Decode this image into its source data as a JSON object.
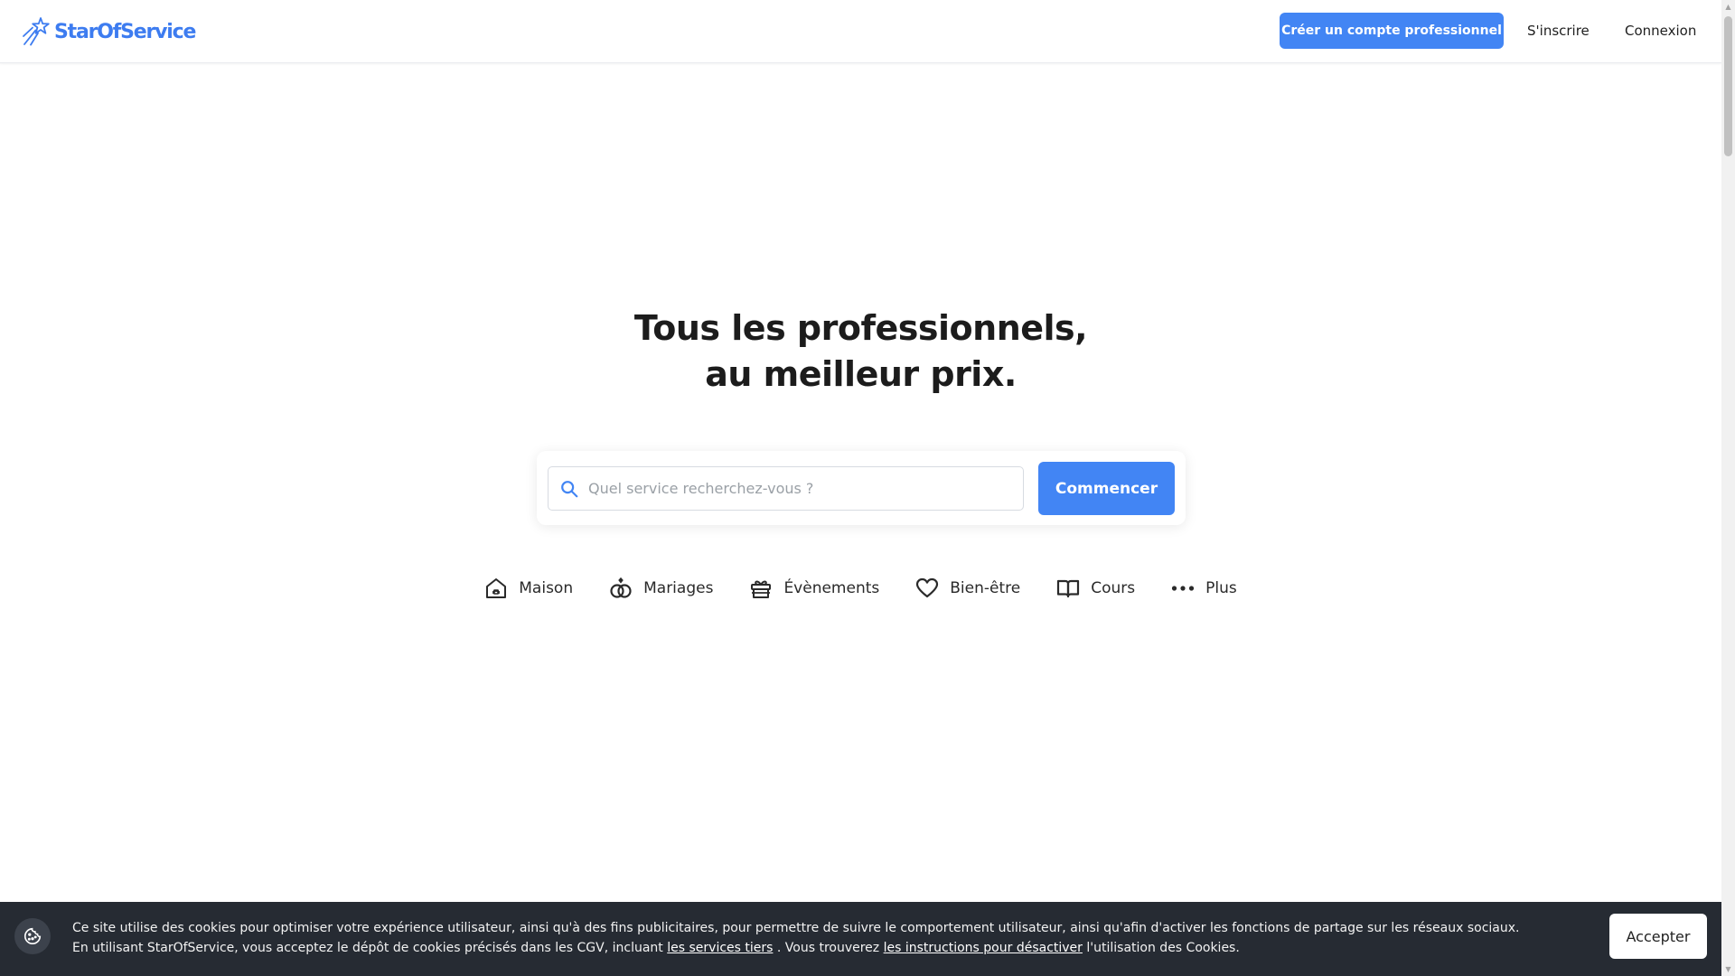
{
  "header": {
    "logo_text": "StarOfService",
    "create_pro_account": "Créer un compte professionnel",
    "signup": "S'inscrire",
    "login": "Connexion"
  },
  "hero": {
    "title_line1": "Tous les professionnels,",
    "title_line2": "au meilleur prix."
  },
  "search": {
    "placeholder": "Quel service recherchez-vous ?",
    "value": "",
    "button": "Commencer"
  },
  "categories": [
    {
      "label": "Maison",
      "icon": "house-icon"
    },
    {
      "label": "Mariages",
      "icon": "rings-icon"
    },
    {
      "label": "Évènements",
      "icon": "gift-icon"
    },
    {
      "label": "Bien-être",
      "icon": "heart-icon"
    },
    {
      "label": "Cours",
      "icon": "open-book-icon"
    },
    {
      "label": "Plus",
      "icon": "more-dots-icon"
    }
  ],
  "cookie_banner": {
    "text_1": "Ce site utilise des cookies pour optimiser votre expérience utilisateur, ainsi qu'à des fins publicitaires, pour permettre de suivre le comportement utilisateur, ainsi qu'afin d'activer les fonctions de partage sur les réseaux sociaux. En utilisant StarOfService, vous acceptez le dépôt de cookies précisés dans les CGV, incluant",
    "link_services": "les services tiers",
    "text_2": ". Vous trouverez",
    "link_instructions": "les instructions pour désactiver",
    "text_3": "l'utilisation des Cookies.",
    "accept": "Accepter"
  },
  "colors": {
    "brand": "#4285f4",
    "logo": "#3d7cf0",
    "cookie_bg": "#262b33"
  }
}
